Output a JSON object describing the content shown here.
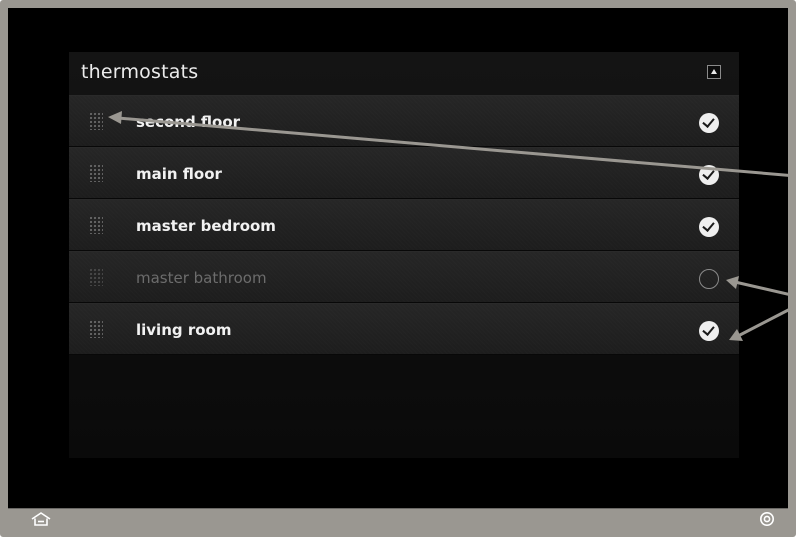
{
  "panel": {
    "title": "thermostats"
  },
  "thermostats": [
    {
      "label": "second floor",
      "selected": true
    },
    {
      "label": "main floor",
      "selected": true
    },
    {
      "label": "master bedroom",
      "selected": true
    },
    {
      "label": "master bathroom",
      "selected": false
    },
    {
      "label": "living room",
      "selected": true
    }
  ],
  "icons": {
    "grip": "drag-handle-icon",
    "selected": "checkmark-circle-icon",
    "unselected": "empty-circle-icon",
    "collapse": "triangle-up-icon",
    "home": "home-icon",
    "settings": "target-icon"
  },
  "colors": {
    "frame": "#9a9791",
    "background": "#000000",
    "row": "#232323",
    "text": "#f2f2f2",
    "disabled_text": "#6c6c6c",
    "arrow": "#9a9791"
  }
}
